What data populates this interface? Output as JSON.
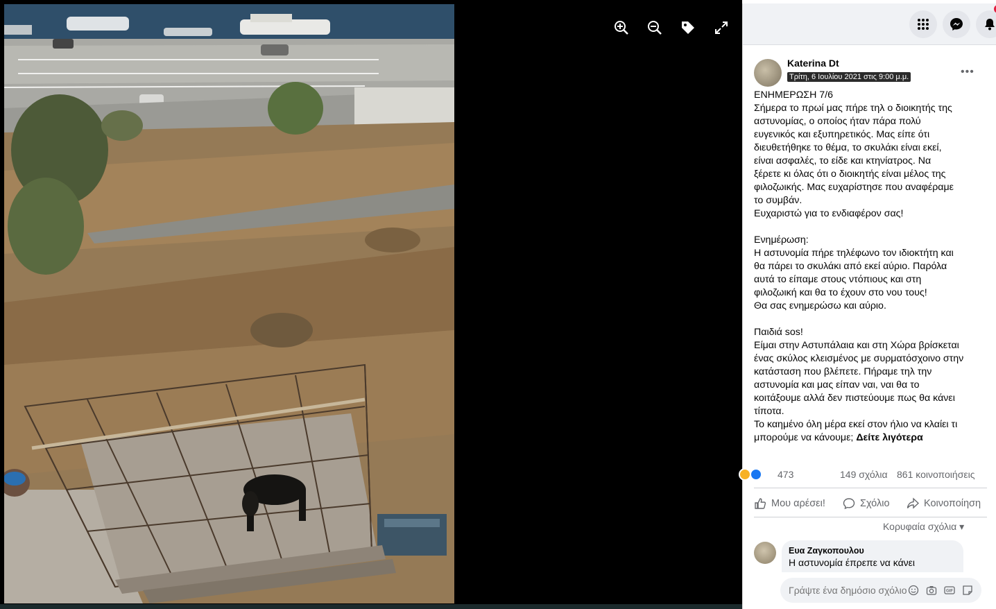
{
  "viewer": {
    "tools": {
      "zoom_in": "zoom-in-icon",
      "zoom_out": "zoom-out-icon",
      "tag": "tag-icon",
      "fullscreen": "fullscreen-icon"
    }
  },
  "header": {
    "menu_icon": "grid-menu-icon",
    "messenger_icon": "messenger-icon",
    "notifications_icon": "bell-icon"
  },
  "post": {
    "author": "Katerina Dt",
    "timestamp": "Τρίτη, 6 Ιουλίου 2021 στις 9:00 μ.μ.",
    "more": "•••",
    "lines": [
      "ΕΝΗΜΕΡΩΣΗ 7/6",
      "Σήμερα το πρωί μας πήρε τηλ ο διοικητής της",
      "αστυνομίας, ο οποίος ήταν πάρα πολύ",
      "ευγενικός και εξυπηρετικός. Μας είπε ότι",
      "διευθετήθηκε το θέμα, το σκυλάκι είναι εκεί,",
      "είναι ασφαλές, το είδε και κτηνίατρος. Να",
      "ξέρετε κι όλας ότι ο διοικητής είναι μέλος της",
      "φιλοζωικής. Μας ευχαρίστησε που αναφέραμε",
      "το συμβάν.",
      "Ευχαριστώ για το ενδιαφέρον σας!",
      "",
      "Ενημέρωση:",
      "Η αστυνομία πήρε τηλέφωνο τον ιδιοκτήτη και",
      "θα πάρει το σκυλάκι από εκεί αύριο. Παρόλα",
      "αυτά το είπαμε στους ντόπιους και στη",
      "φιλοζωική και θα το έχουν στο νου τους!",
      "Θα σας ενημερώσω και αύριο.",
      "",
      "Παιδιά sos!",
      "Είμαι στην Αστυπάλαια και στη Χώρα βρίσκεται",
      "ένας σκύλος κλεισμένος με συρματόσχοινο στην",
      "κατάσταση που βλέπετε. Πήραμε τηλ την",
      "αστυνομία και μας είπαν ναι, ναι θα το",
      "κοιτάξουμε αλλά δεν πιστεύουμε πως θα κάνει",
      "τίποτα.",
      "Το καημένο όλη μέρα εκεί στον ήλιο να κλαίει τι"
    ],
    "last_line": "μπορούμε να κάνουμε;",
    "see_more": "Δείτε λιγότερα",
    "reaction_count": "473",
    "comments": "149 σχόλια",
    "shares": "861 κοινοποιήσεις",
    "actions": {
      "like": "Μου αρέσει!",
      "comment": "Σχόλιο",
      "share": "Κοινοποίηση"
    },
    "top_comments": "Κορυφαία σχόλια ▾",
    "first_comment": {
      "author": "Ευα Ζαγκοπουλου",
      "text": "Η αστυνομία έπρεπε να κάνει"
    },
    "comment_input_placeholder": "Γράψτε ένα δημόσιο σχόλιο..."
  },
  "colors": {
    "like_blue": "#1877f2",
    "haha_yellow": "#f7b125",
    "panel_bg": "#ffffff",
    "muted_text": "#65676b"
  }
}
